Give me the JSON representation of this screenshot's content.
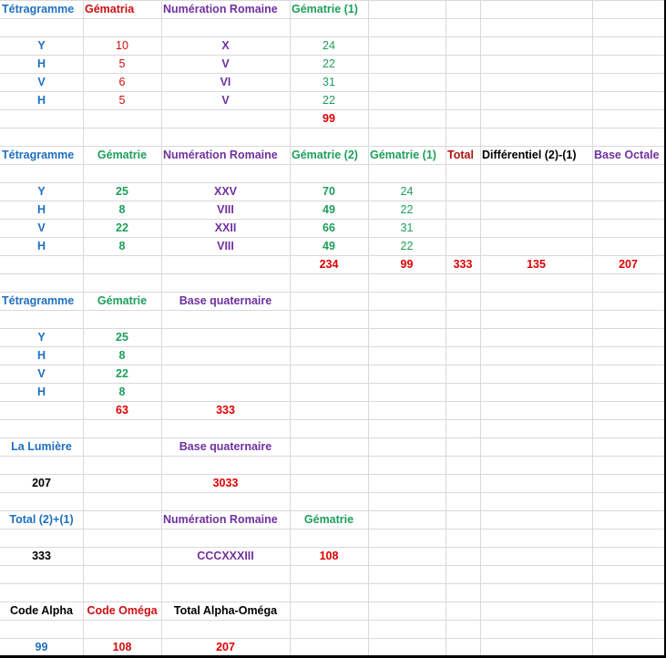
{
  "sheet": {
    "rows": [
      [
        "Tétragramme",
        "Gématria",
        "Numération Romaine",
        "Gématrie (1)",
        "",
        "",
        "",
        ""
      ],
      [
        "",
        "",
        "",
        "",
        "",
        "",
        "",
        ""
      ],
      [
        "Y",
        "10",
        "X",
        "24",
        "",
        "",
        "",
        ""
      ],
      [
        "H",
        "5",
        "V",
        "22",
        "",
        "",
        "",
        ""
      ],
      [
        "V",
        "6",
        "VI",
        "31",
        "",
        "",
        "",
        ""
      ],
      [
        "H",
        "5",
        "V",
        "22",
        "",
        "",
        "",
        ""
      ],
      [
        "",
        "",
        "",
        "99",
        "",
        "",
        "",
        ""
      ],
      [
        "",
        "",
        "",
        "",
        "",
        "",
        "",
        ""
      ],
      [
        "Tétragramme",
        "Gématrie",
        "Numération Romaine",
        "Gématrie (2)",
        "Gématrie (1)",
        "Total",
        "Différentiel (2)-(1)",
        "Base Octale"
      ],
      [
        "",
        "",
        "",
        "",
        "",
        "",
        "",
        ""
      ],
      [
        "Y",
        "25",
        "XXV",
        "70",
        "24",
        "",
        "",
        ""
      ],
      [
        "H",
        "8",
        "VIII",
        "49",
        "22",
        "",
        "",
        ""
      ],
      [
        "V",
        "22",
        "XXII",
        "66",
        "31",
        "",
        "",
        ""
      ],
      [
        "H",
        "8",
        "VIII",
        "49",
        "22",
        "",
        "",
        ""
      ],
      [
        "",
        "",
        "",
        "234",
        "99",
        "333",
        "135",
        "207"
      ],
      [
        "",
        "",
        "",
        "",
        "",
        "",
        "",
        ""
      ],
      [
        "Tétragramme",
        "Gématrie",
        "Base quaternaire",
        "",
        "",
        "",
        "",
        ""
      ],
      [
        "",
        "",
        "",
        "",
        "",
        "",
        "",
        ""
      ],
      [
        "Y",
        "25",
        "",
        "",
        "",
        "",
        "",
        ""
      ],
      [
        "H",
        "8",
        "",
        "",
        "",
        "",
        "",
        ""
      ],
      [
        "V",
        "22",
        "",
        "",
        "",
        "",
        "",
        ""
      ],
      [
        "H",
        "8",
        "",
        "",
        "",
        "",
        "",
        ""
      ],
      [
        "",
        "63",
        "333",
        "",
        "",
        "",
        "",
        ""
      ],
      [
        "",
        "",
        "",
        "",
        "",
        "",
        "",
        ""
      ],
      [
        "La Lumière",
        "",
        "Base quaternaire",
        "",
        "",
        "",
        "",
        ""
      ],
      [
        "",
        "",
        "",
        "",
        "",
        "",
        "",
        ""
      ],
      [
        "207",
        "",
        "3033",
        "",
        "",
        "",
        "",
        ""
      ],
      [
        "",
        "",
        "",
        "",
        "",
        "",
        "",
        ""
      ],
      [
        "Total (2)+(1)",
        "",
        "Numération Romaine",
        "Gématrie",
        "",
        "",
        "",
        ""
      ],
      [
        "",
        "",
        "",
        "",
        "",
        "",
        "",
        ""
      ],
      [
        "333",
        "",
        "CCCXXXIII",
        "108",
        "",
        "",
        "",
        ""
      ],
      [
        "",
        "",
        "",
        "",
        "",
        "",
        "",
        ""
      ],
      [
        "",
        "",
        "",
        "",
        "",
        "",
        "",
        ""
      ],
      [
        "Code Alpha",
        "Code Oméga",
        "Total Alpha-Oméga",
        "",
        "",
        "",
        "",
        ""
      ],
      [
        "",
        "",
        "",
        "",
        "",
        "",
        "",
        ""
      ],
      [
        "99",
        "108",
        "207",
        "",
        "",
        "",
        "",
        ""
      ]
    ],
    "colors": {
      "blue": "#1f6fbf",
      "red": "#cc1010",
      "green": "#1e9e5a",
      "purple": "#7030a0",
      "black": "#000000",
      "gridline": "#d9d9d9"
    }
  }
}
